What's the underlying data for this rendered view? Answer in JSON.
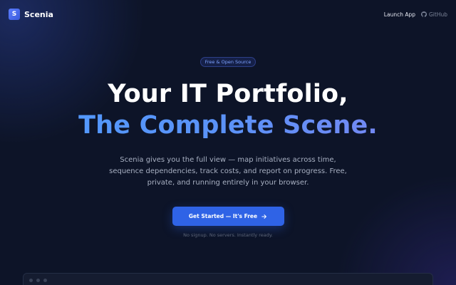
{
  "nav": {
    "brand_letter": "S",
    "brand_name": "Scenia",
    "launch_label": "Launch App",
    "github_label": "GitHub",
    "github_icon": "github-icon"
  },
  "hero": {
    "badge": "Free & Open Source",
    "headline_line1": "Your IT Portfolio,",
    "headline_line2": "The Complete Scene.",
    "subtitle": "Scenia gives you the full view — map initiatives across time, sequence dependencies, track costs, and report on progress. Free, private, and running entirely in your browser.",
    "cta_label": "Get Started — It's Free",
    "cta_icon": "arrow-right-icon",
    "note": "No signup. No servers. Instantly ready."
  },
  "colors": {
    "background": "#0d1428",
    "accent": "#2f63e6",
    "gradient_start": "#4f9bff",
    "gradient_end": "#7f84f2"
  }
}
